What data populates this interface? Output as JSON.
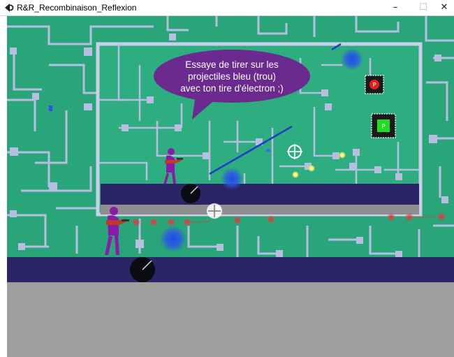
{
  "window": {
    "title": "R&R_Recombinaison_Reflexion",
    "minimize": "–",
    "maximize": "☐",
    "close": "✕"
  },
  "tutorial": {
    "line1": "Essaye de tirer sur les",
    "line2": "projectiles bleu (trou)",
    "line3": "avec ton tire d'électron ;)"
  },
  "chips": {
    "red_label": "P",
    "green_label": "P"
  },
  "colors": {
    "board": "#2aa57a",
    "traces": "#b7bfe0",
    "platform": "#2b2466",
    "floor": "#9e9e9e",
    "bubble": "#6a2a8e",
    "player": "#8a1aa8",
    "electron_shot": "#e23b3b",
    "hole_projectile": "#1f4de8",
    "red_chip": "#e02020",
    "green_chip": "#22dd22"
  },
  "icons": {
    "app": "game-logo-icon",
    "crosshair": "crosshair-icon"
  }
}
